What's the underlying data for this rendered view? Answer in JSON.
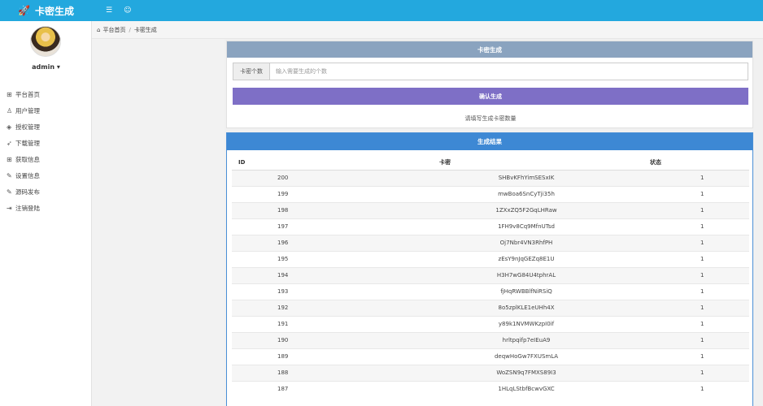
{
  "header": {
    "brand": "卡密生成",
    "brand_icon": "rocket-icon",
    "menu_toggle_icon": "list-icon",
    "user_icon": "user-icon",
    "accent": "#23a8de"
  },
  "sidebar": {
    "username": "admin ▾",
    "items": [
      {
        "label": "平台首页",
        "icon": "grid-icon"
      },
      {
        "label": "用户管理",
        "icon": "user-icon"
      },
      {
        "label": "授权管理",
        "icon": "layers-icon"
      },
      {
        "label": "下载管理",
        "icon": "rocket-icon"
      },
      {
        "label": "获取信息",
        "icon": "grid-icon"
      },
      {
        "label": "设置信息",
        "icon": "edit-icon"
      },
      {
        "label": "源码发布",
        "icon": "edit-icon"
      },
      {
        "label": "注销登陆",
        "icon": "logout-icon"
      }
    ]
  },
  "breadcrumb": {
    "home_icon": "home-icon",
    "home": "平台首页",
    "separator": "/",
    "current": "卡密生成"
  },
  "generate": {
    "title": "卡密生成",
    "count_label": "卡密个数",
    "count_value": "",
    "count_placeholder": "输入需要生成的个数",
    "confirm_button": "确认生成",
    "hint": "请填写生成卡密数量",
    "header_color": "#8aa3bf",
    "button_color": "#7e6fc6"
  },
  "results": {
    "title": "生成结果",
    "header_color": "#3d88d4",
    "columns": [
      "ID",
      "卡密",
      "状态"
    ],
    "rows": [
      {
        "id": "200",
        "card": "SHBvKFhYimSESxIK",
        "status": "1"
      },
      {
        "id": "199",
        "card": "mwBoa6SnCyTji35h",
        "status": "1"
      },
      {
        "id": "198",
        "card": "1ZXxZQ5F2GqLHRaw",
        "status": "1"
      },
      {
        "id": "197",
        "card": "1FH9v8Cq9MfnUTsd",
        "status": "1"
      },
      {
        "id": "196",
        "card": "Oj7Nbr4VN3RhfPH",
        "status": "1"
      },
      {
        "id": "195",
        "card": "zEsY9nJqGEZq8E1U",
        "status": "1"
      },
      {
        "id": "194",
        "card": "H3H7wG84U4tphrAL",
        "status": "1"
      },
      {
        "id": "193",
        "card": "fjHqRWBBlfNiRSiQ",
        "status": "1"
      },
      {
        "id": "192",
        "card": "8o5zplKLE1eUHh4X",
        "status": "1"
      },
      {
        "id": "191",
        "card": "y89k1NVMWKzpI0if",
        "status": "1"
      },
      {
        "id": "190",
        "card": "hrltpqifp7eIEuA9",
        "status": "1"
      },
      {
        "id": "189",
        "card": "deqwHoGw7FXUSmLA",
        "status": "1"
      },
      {
        "id": "188",
        "card": "WoZSN9q7FMXS89I3",
        "status": "1"
      },
      {
        "id": "187",
        "card": "1HLqLStbfBcwvGXC",
        "status": "1"
      }
    ]
  }
}
